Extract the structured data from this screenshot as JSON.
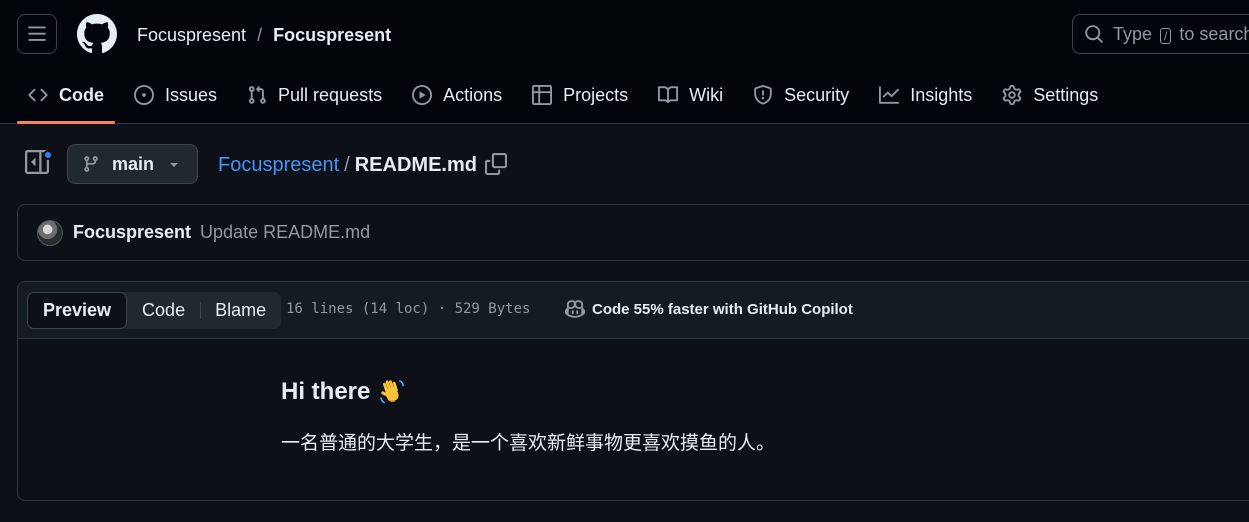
{
  "header": {
    "owner": "Focuspresent",
    "separator": "/",
    "repo": "Focuspresent",
    "search": {
      "before": "Type",
      "key": "/",
      "after": "to search"
    }
  },
  "nav": {
    "tabs": [
      {
        "label": "Code",
        "icon": "code-icon",
        "selected": true
      },
      {
        "label": "Issues",
        "icon": "issue-opened-icon",
        "selected": false
      },
      {
        "label": "Pull requests",
        "icon": "git-pull-request-icon",
        "selected": false
      },
      {
        "label": "Actions",
        "icon": "play-icon",
        "selected": false
      },
      {
        "label": "Projects",
        "icon": "table-icon",
        "selected": false
      },
      {
        "label": "Wiki",
        "icon": "book-icon",
        "selected": false
      },
      {
        "label": "Security",
        "icon": "shield-icon",
        "selected": false
      },
      {
        "label": "Insights",
        "icon": "graph-icon",
        "selected": false
      },
      {
        "label": "Settings",
        "icon": "gear-icon",
        "selected": false
      }
    ]
  },
  "file_header": {
    "branch": "main",
    "repo_link": "Focuspresent",
    "path_sep": "/",
    "filename": "README.md"
  },
  "commit": {
    "author": "Focuspresent",
    "message": "Update README.md"
  },
  "viewer": {
    "modes": [
      "Preview",
      "Code",
      "Blame"
    ],
    "active_mode": "Preview",
    "info": "16 lines (14 loc) · 529 Bytes",
    "copilot": "Code 55% faster with GitHub Copilot"
  },
  "readme": {
    "heading": "Hi there",
    "heading_emoji": "👋",
    "paragraph": "一名普通的大学生，是一个喜欢新鲜事物更喜欢摸鱼的人。"
  },
  "colors": {
    "accent_underline": "#f78166",
    "link": "#4493f8",
    "notification_dot": "#2f81f7"
  }
}
